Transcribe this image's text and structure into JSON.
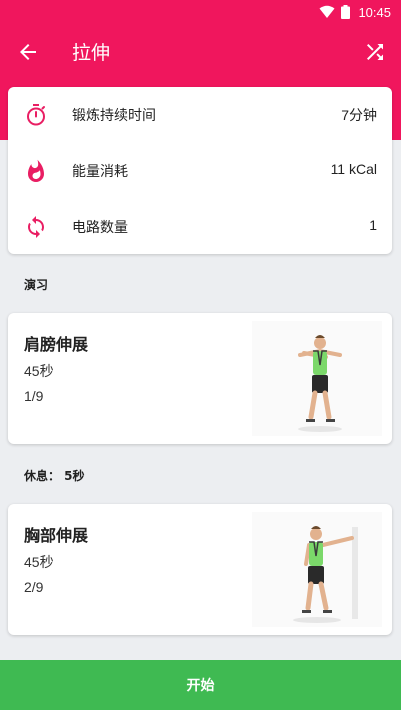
{
  "status_bar": {
    "time": "10:45"
  },
  "app_bar": {
    "title": "拉伸"
  },
  "stats": [
    {
      "label": "锻炼持续时间",
      "value": "7分钟",
      "icon": "stopwatch-icon"
    },
    {
      "label": "能量消耗",
      "value": "11 kCal",
      "icon": "flame-icon"
    },
    {
      "label": "电路数量",
      "value": "1",
      "icon": "repeat-icon"
    }
  ],
  "section_title": "演习",
  "rest_label": "休息： 5秒",
  "exercises": [
    {
      "name": "肩膀伸展",
      "duration": "45秒",
      "index": "1/9"
    },
    {
      "name": "胸部伸展",
      "duration": "45秒",
      "index": "2/9"
    }
  ],
  "start_button": {
    "label": "开始"
  },
  "colors": {
    "primary": "#f0165d",
    "start": "#3fba52"
  }
}
